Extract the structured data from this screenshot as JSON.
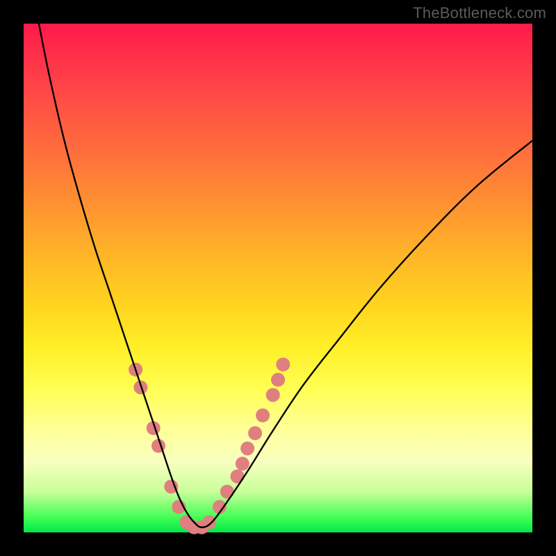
{
  "watermark": "TheBottleneck.com",
  "chart_data": {
    "type": "line",
    "title": "",
    "xlabel": "",
    "ylabel": "",
    "xlim": [
      0,
      100
    ],
    "ylim": [
      0,
      100
    ],
    "grid": false,
    "legend": false,
    "series": [
      {
        "name": "bottleneck-curve",
        "color": "#000000",
        "x": [
          3,
          5,
          8,
          11,
          14,
          17,
          19,
          21,
          23,
          25,
          27,
          29,
          30.5,
          32,
          33.5,
          35,
          37,
          40,
          44,
          49,
          55,
          62,
          70,
          79,
          89,
          100
        ],
        "y": [
          100,
          90,
          77,
          66,
          56,
          47,
          41,
          35,
          29,
          23,
          17,
          11,
          7,
          4,
          2,
          1,
          2,
          6,
          12,
          20,
          29,
          38,
          48,
          58,
          68,
          77
        ]
      }
    ],
    "markers": {
      "name": "highlight-dots",
      "color": "#e07f7f",
      "radius_px": 10,
      "points": [
        {
          "x": 22.0,
          "y": 32.0
        },
        {
          "x": 23.0,
          "y": 28.5
        },
        {
          "x": 25.5,
          "y": 20.5
        },
        {
          "x": 26.5,
          "y": 17.0
        },
        {
          "x": 29.0,
          "y": 9.0
        },
        {
          "x": 30.5,
          "y": 5.0
        },
        {
          "x": 32.0,
          "y": 2.0
        },
        {
          "x": 33.5,
          "y": 1.0
        },
        {
          "x": 35.0,
          "y": 1.0
        },
        {
          "x": 36.5,
          "y": 2.0
        },
        {
          "x": 38.5,
          "y": 5.0
        },
        {
          "x": 40.0,
          "y": 8.0
        },
        {
          "x": 42.0,
          "y": 11.0
        },
        {
          "x": 43.0,
          "y": 13.5
        },
        {
          "x": 44.0,
          "y": 16.5
        },
        {
          "x": 45.5,
          "y": 19.5
        },
        {
          "x": 47.0,
          "y": 23.0
        },
        {
          "x": 49.0,
          "y": 27.0
        },
        {
          "x": 50.0,
          "y": 30.0
        },
        {
          "x": 51.0,
          "y": 33.0
        }
      ]
    }
  }
}
